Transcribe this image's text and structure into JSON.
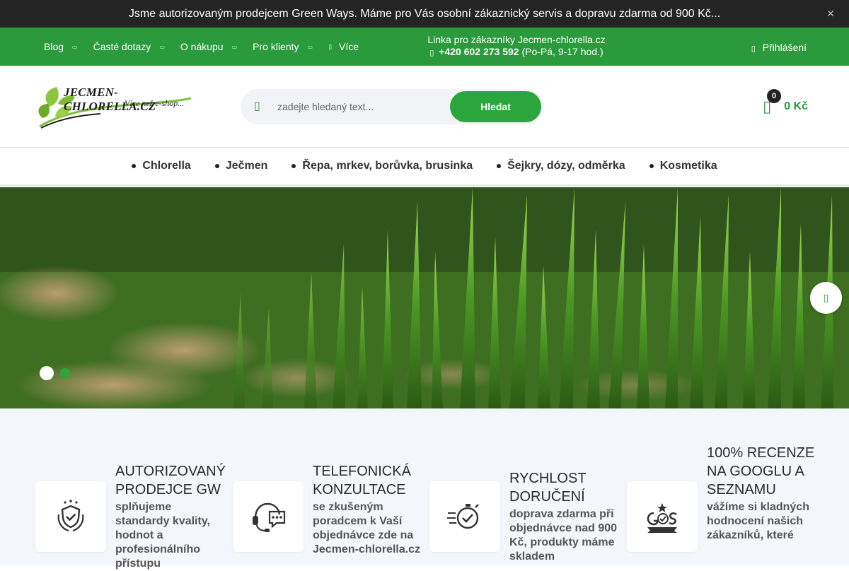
{
  "topbar": {
    "message": "Jsme autorizovaným prodejcem Green Ways. Máme pro Vás osobní zákaznický servis a dopravu zdarma od 900 Kč...",
    "close_icon": "close-icon"
  },
  "nav": {
    "items": [
      {
        "label": "Blog"
      },
      {
        "label": "Časté dotazy"
      },
      {
        "label": "O nákupu"
      },
      {
        "label": "Pro klienty"
      }
    ],
    "more_label": "Více",
    "hotline_title": "Linka pro zákazníky Jecmen-chlorella.cz",
    "phone": "+420 602 273 592",
    "hours": "(Po-Pá, 9-17 hod.)",
    "login_label": "Přihlášení"
  },
  "header": {
    "logo_text": "JECMEN-CHLORELLA.CZ",
    "logo_tagline": "Více než e-shop...",
    "search_placeholder": "zadejte hledaný text...",
    "search_button": "Hledat",
    "cart_count": "0",
    "cart_total": "0 Kč"
  },
  "categories": [
    {
      "label": "Chlorella"
    },
    {
      "label": "Ječmen"
    },
    {
      "label": "Řepa, mrkev, borůvka, brusinka"
    },
    {
      "label": "Šejkry, dózy, odměrka"
    },
    {
      "label": "Kosmetika"
    }
  ],
  "hero": {
    "slides_count": 2,
    "active_slide": 1
  },
  "benefits": [
    {
      "icon": "shield-laurel-icon",
      "title": "AUTORIZOVANÝ PRODEJCE GW",
      "desc": "splňujeme standardy kvality, hodnot a profesionálního přístupu"
    },
    {
      "icon": "headset-icon",
      "title": "TELEFONICKÁ KONZULTACE",
      "desc": "se zkušeným poradcem k Vaší objednávce zde na Jecmen-chlorella.cz"
    },
    {
      "icon": "stopwatch-icon",
      "title": "RYCHLOST DORUČENÍ",
      "desc": "doprava zdarma při objednávce nad 900 Kč, produkty máme skladem"
    },
    {
      "icon": "google-seznam-100-icon",
      "title": "100% RECENZE NA GOOGLU A SEZNAMU",
      "desc": "vážíme si kladných hodnocení našich zákazníků, které"
    }
  ],
  "colors": {
    "brand_green": "#2a9a3c",
    "button_green": "#2aa63c",
    "topbar_bg": "#242424",
    "benefits_bg": "#f3f6fa"
  }
}
